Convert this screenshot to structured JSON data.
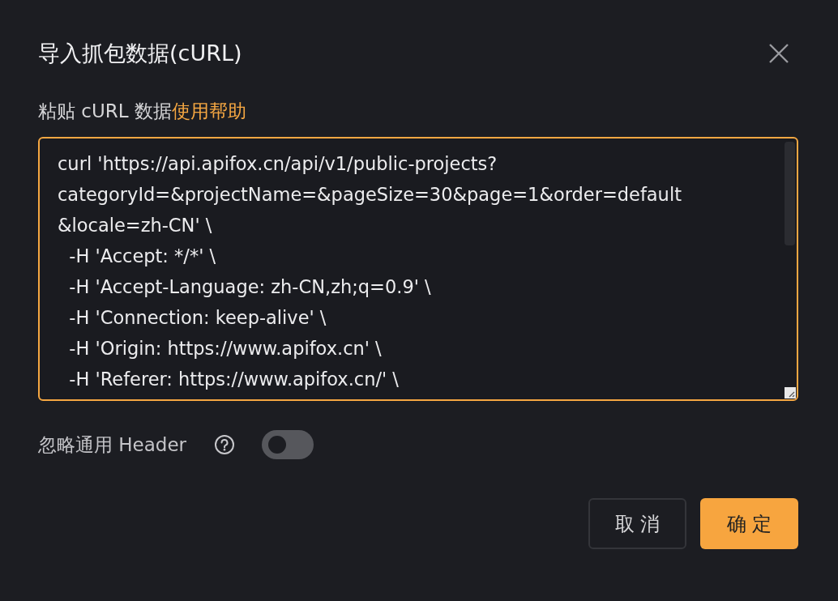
{
  "dialog": {
    "title": "导入抓包数据(cURL)"
  },
  "field_label": {
    "text": "粘贴 cURL 数据",
    "help_link": "使用帮助"
  },
  "curl_input": {
    "lines": [
      "curl 'https://api.apifox.cn/api/v1/public-projects?",
      "categoryId=&projectName=&pageSize=30&page=1&order=default",
      "&locale=zh-CN' \\",
      "  -H 'Accept: */*' \\",
      "  -H 'Accept-Language: zh-CN,zh;q=0.9' \\",
      "  -H 'Connection: keep-alive' \\",
      "  -H 'Origin: https://www.apifox.cn' \\",
      "  -H 'Referer: https://www.apifox.cn/' \\"
    ]
  },
  "ignore_header": {
    "label": "忽略通用 Header",
    "on": false
  },
  "buttons": [
    {
      "label": "取 消",
      "kind": "secondary"
    },
    {
      "label": "确 定",
      "kind": "primary"
    }
  ]
}
